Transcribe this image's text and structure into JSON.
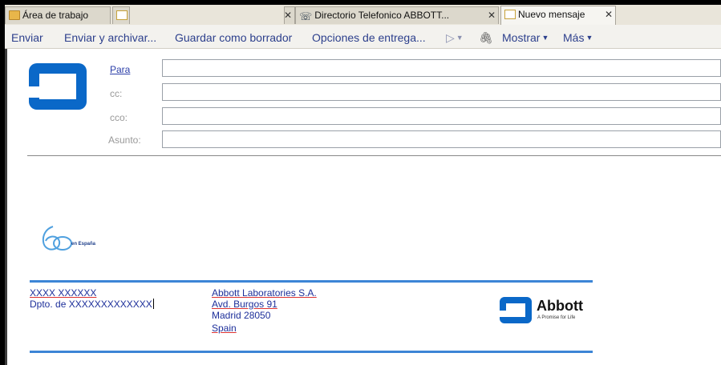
{
  "tabs": [
    {
      "label": "Área de trabajo",
      "icon": "folder-icon"
    },
    {
      "label": "",
      "icon": "document-icon"
    },
    {
      "label": "Directorio Telefonico ABBOTT...",
      "icon": "directory-icon"
    },
    {
      "label": "Nuevo mensaje",
      "icon": "new-message-icon"
    }
  ],
  "toolbar": {
    "send": "Enviar",
    "send_archive": "Enviar y archivar...",
    "save_draft": "Guardar como borrador",
    "delivery_options": "Opciones de entrega...",
    "show": "Mostrar",
    "more": "Más"
  },
  "fields": {
    "to": "Para",
    "cc": "cc:",
    "bcc": "cco:",
    "subject": "Asunto:"
  },
  "sixty_text": "en España",
  "signature": {
    "name": "XXXX XXXXXX",
    "dept": "Dpto. de XXXXXXXXXXXXX",
    "company": "Abbott Laboratories S.A.",
    "street": "Avd. Burgos 91",
    "city": "Madrid 28050",
    "country": "Spain",
    "brand": "Abbott",
    "tagline": "A Promise for Life"
  },
  "colors": {
    "accent": "#0a68c8",
    "link": "#2c3f8c",
    "rule": "#3c85d6"
  }
}
